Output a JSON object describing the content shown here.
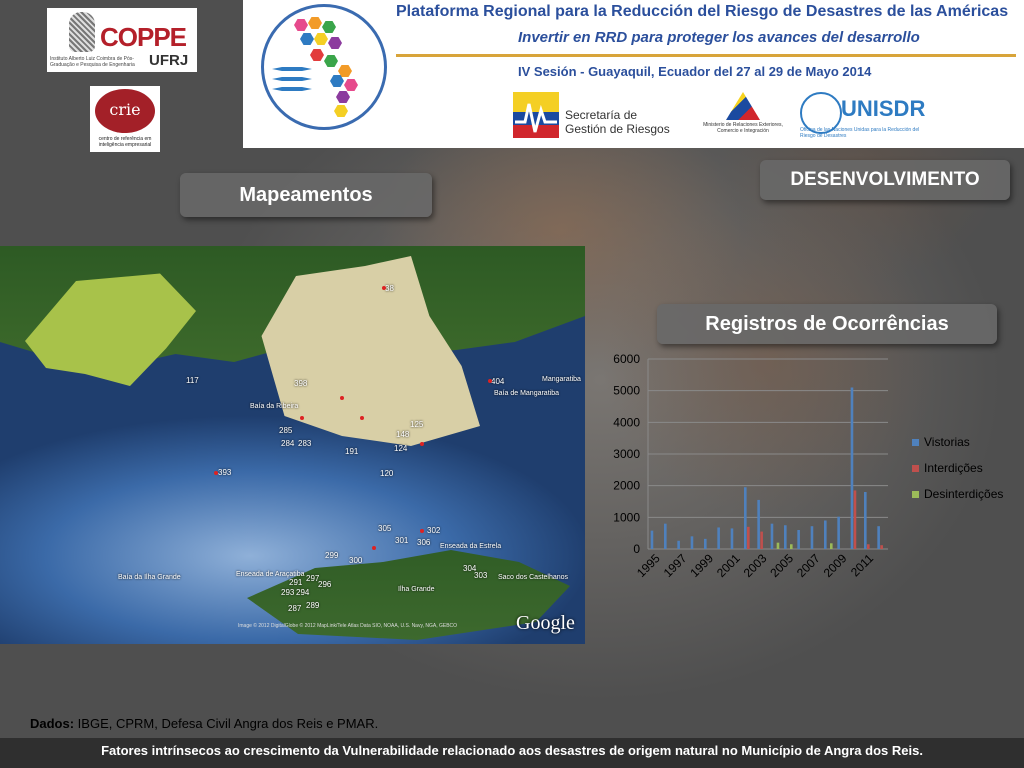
{
  "logos": {
    "coppe_word": "COPPE",
    "coppe_ufrj": "UFRJ",
    "coppe_sub": "Instituto Alberto Luiz Coimbra de Pós-Graduação e Pesquisa de Engenharia",
    "crie_word": "crie",
    "crie_sub": "centro de referência em inteligência empresarial"
  },
  "banner": {
    "title": "Plataforma Regional para la Reducción del Riesgo de Desastres de las Américas",
    "subtitle": "Invertir en RRD para proteger los avances del desarrollo",
    "session": "IV Sesión - Guayaquil, Ecuador del 27 al 29 de Mayo 2014",
    "sgr_text_1": "Secretaría de",
    "sgr_text_2": "Gestión de Riesgos",
    "mre_text": "Ministerio de Relaciones Exteriores, Comercio e Integración",
    "unisdr": "UNISDR",
    "unisdr_sub": "Oficina de las Naciones Unidas para la Reducción del Riesgo de Desastres"
  },
  "labels": {
    "desenvolvimento": "DESENVOLVIMENTO",
    "mapeamentos": "Mapeamentos",
    "registros": "Registros de Ocorrências"
  },
  "map": {
    "place_labels": [
      "Mangaratiba",
      "Baía de Mangaratiba",
      "Baía da Ribeira",
      "Baía da Ilha Grande",
      "Enseada de Araçatiba",
      "Enseada da Estrela",
      "Saco dos Castelhanos",
      "Ilha Grande"
    ],
    "numbers": [
      "38",
      "398",
      "404",
      "393",
      "305",
      "302",
      "301",
      "306",
      "299",
      "300",
      "304",
      "303",
      "291",
      "293",
      "294",
      "287",
      "289",
      "297",
      "296",
      "120",
      "124",
      "125",
      "148",
      "191",
      "285",
      "284",
      "283",
      "117"
    ],
    "credits": "Image © 2012 DigitalGlobe © 2012 MapLink/Tele Atlas Data SIO, NOAA, U.S. Navy, NGA, GEBCO",
    "google": "Google"
  },
  "chart_data": {
    "type": "bar",
    "title": "",
    "xlabel": "",
    "ylabel": "",
    "ylim": [
      0,
      6000
    ],
    "yticks": [
      0,
      1000,
      2000,
      3000,
      4000,
      5000,
      6000
    ],
    "categories": [
      "1995",
      "1996",
      "1997",
      "1998",
      "1999",
      "2000",
      "2001",
      "2002",
      "2003",
      "2004",
      "2005",
      "2006",
      "2007",
      "2008",
      "2009",
      "2010",
      "2011",
      "2012"
    ],
    "x_tick_labels": [
      "1995",
      "1997",
      "1999",
      "2001",
      "2003",
      "2005",
      "2007",
      "2009",
      "2011"
    ],
    "legend_position": "right",
    "series": [
      {
        "name": "Vistorias",
        "color": "#4f81bd",
        "values": [
          580,
          800,
          260,
          400,
          320,
          680,
          650,
          1950,
          1550,
          800,
          750,
          600,
          720,
          900,
          1020,
          5100,
          1800,
          720
        ]
      },
      {
        "name": "Interdições",
        "color": "#c0504d",
        "values": [
          0,
          0,
          0,
          0,
          0,
          0,
          0,
          700,
          550,
          0,
          0,
          0,
          0,
          0,
          0,
          1850,
          150,
          120
        ]
      },
      {
        "name": "Desinterdições",
        "color": "#9bbb59",
        "values": [
          0,
          0,
          0,
          0,
          0,
          0,
          0,
          0,
          0,
          200,
          150,
          0,
          0,
          180,
          0,
          0,
          0,
          0
        ]
      }
    ]
  },
  "source": {
    "label": "Dados:",
    "text": " IBGE, CPRM, Defesa Civil Angra dos Reis e PMAR."
  },
  "footer": "Fatores intrínsecos  ao  crescimento da Vulnerabilidade  relacionado  aos desastres  de origem natural no Município de Angra  dos Reis."
}
